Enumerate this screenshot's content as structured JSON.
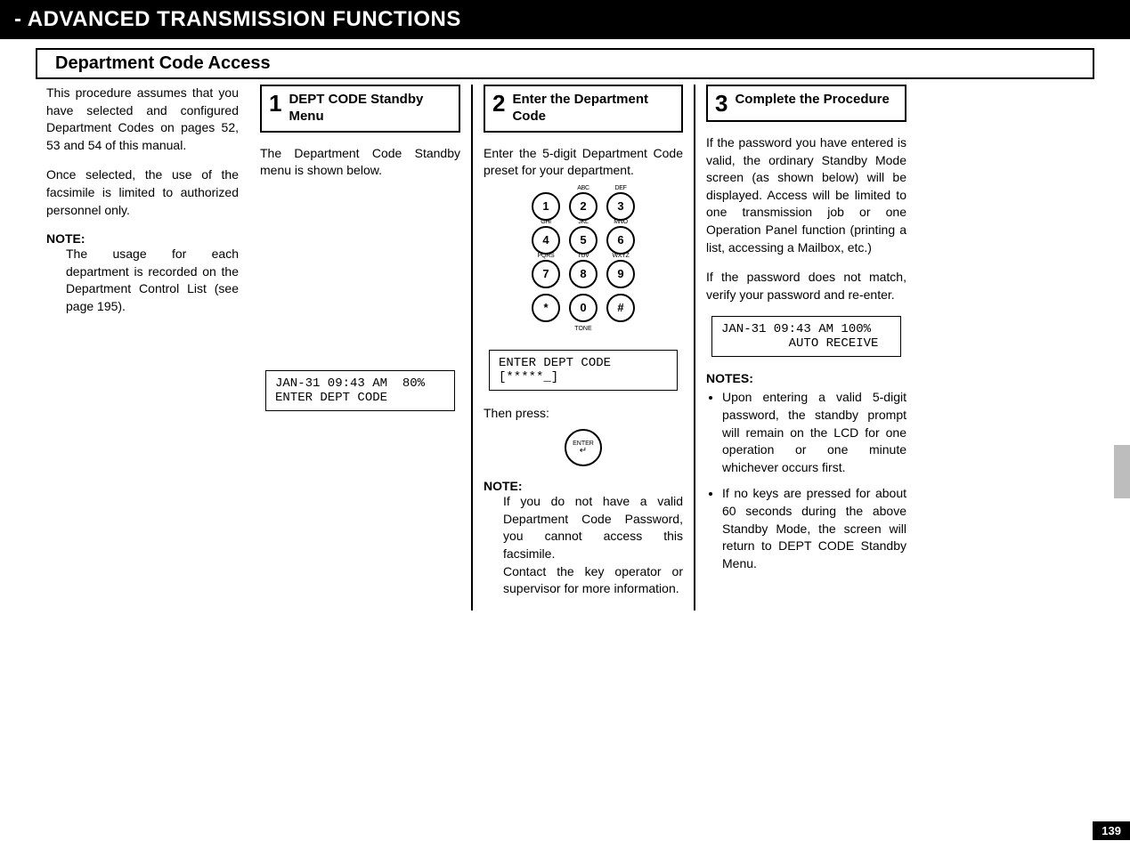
{
  "header": {
    "title": "- ADVANCED TRANSMISSION FUNCTIONS"
  },
  "section_title": "Department  Code  Access",
  "page_number": "139",
  "intro": {
    "p1": "This procedure assumes that you have selected and configured Department Codes on pages 52, 53 and 54 of this manual.",
    "p2": "Once selected, the use of the facsimile is limited to authorized personnel only.",
    "note_label": "NOTE:",
    "note_body": "The usage for each department is recorded on the Department Control List (see page 195)."
  },
  "steps": [
    {
      "num": "1",
      "title": "DEPT CODE Standby Menu",
      "body": "The Department Code Standby menu is shown below.",
      "lcd": "JAN-31 09:43 AM  80%\nENTER DEPT CODE"
    },
    {
      "num": "2",
      "title": "Enter the Department Code",
      "body": "Enter the 5-digit Department Code preset for your department.",
      "lcd": "ENTER DEPT CODE\n[*****_]",
      "then": "Then press:",
      "enter_label": "ENTER",
      "note_label": "NOTE:",
      "note_body": "If you do not have a valid Department Code Password, you cannot access this facsimile.\nContact the key operator or supervisor for more information."
    },
    {
      "num": "3",
      "title": "Complete the Procedure",
      "body1": "If the password you have entered is valid, the ordinary Standby Mode screen (as shown below) will be displayed. Access will be limited to one transmission job or one Operation Panel function (printing a list, accessing a Mailbox, etc.)",
      "body2": "If the password does not match, verify your password and re-enter.",
      "lcd": "JAN-31 09:43 AM 100%\n         AUTO RECEIVE",
      "notes_label": "NOTES:",
      "notes": [
        "Upon entering a valid 5-digit password, the standby prompt will remain on the LCD for one operation or one minute whichever occurs first.",
        "If no keys are pressed for about 60 seconds during the above Standby Mode, the screen will return to DEPT CODE Standby Menu."
      ]
    }
  ],
  "keypad": {
    "rows": [
      [
        {
          "d": "1",
          "s": ""
        },
        {
          "d": "2",
          "s": "ABC"
        },
        {
          "d": "3",
          "s": "DEF"
        }
      ],
      [
        {
          "d": "4",
          "s": "GHI"
        },
        {
          "d": "5",
          "s": "JKL"
        },
        {
          "d": "6",
          "s": "MNO"
        }
      ],
      [
        {
          "d": "7",
          "s": "PQRS"
        },
        {
          "d": "8",
          "s": "TUV"
        },
        {
          "d": "9",
          "s": "WXYZ"
        }
      ],
      [
        {
          "d": "*",
          "s": ""
        },
        {
          "d": "0",
          "s": ""
        },
        {
          "d": "#",
          "s": ""
        }
      ]
    ],
    "tone": "TONE"
  }
}
